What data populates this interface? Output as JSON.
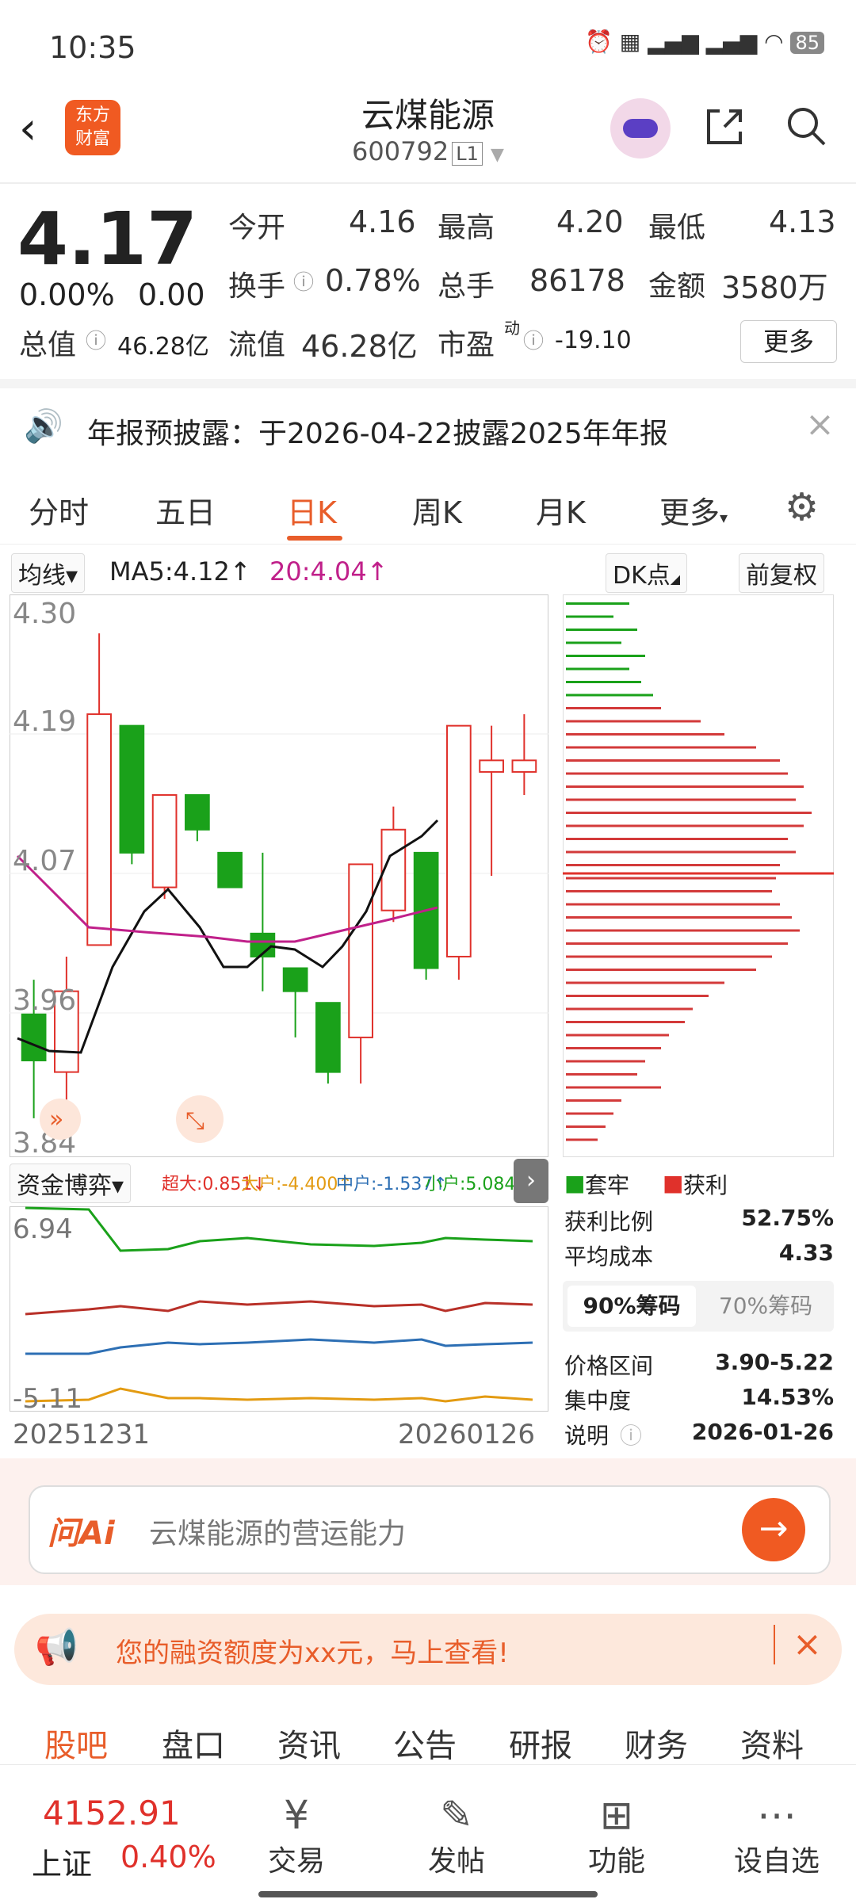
{
  "status_bar": {
    "time": "10:35",
    "battery": "85"
  },
  "header": {
    "back_icon": "chevron-left-icon",
    "logo_text_line1": "东方",
    "logo_text_line2": "财富",
    "title": "云煤能源",
    "code": "600792",
    "level": "L1"
  },
  "quote": {
    "price": "4.17",
    "change_pct": "0.00%",
    "change_abs": "0.00",
    "open_label": "今开",
    "open": "4.16",
    "high_label": "最高",
    "high": "4.20",
    "low_label": "最低",
    "low": "4.13",
    "turnover_label": "换手",
    "turnover": "0.78%",
    "volume_label": "总手",
    "volume": "86178",
    "amount_label": "金额",
    "amount": "3580万",
    "mktcap_label": "总值",
    "mktcap": "46.28亿",
    "float_label": "流值",
    "float": "46.28亿",
    "pe_label": "市盈",
    "pe_sup": "动",
    "pe": "-19.10",
    "more_label": "更多"
  },
  "notice": {
    "text": "年报预披露：于2026-04-22披露2025年年报"
  },
  "tabs": [
    {
      "label": "分时"
    },
    {
      "label": "五日"
    },
    {
      "label": "日K"
    },
    {
      "label": "周K"
    },
    {
      "label": "月K"
    },
    {
      "label": "更多"
    }
  ],
  "toolbar": {
    "indicator": "均线",
    "ma5": "MA5:4.12↑",
    "ma20": "20:4.04↑",
    "dk": "DK点",
    "adjust": "前复权"
  },
  "chart": {
    "y_labels": [
      "4.30",
      "4.19",
      "4.07",
      "3.96",
      "3.84"
    ],
    "sub_indicator": "资金博弈",
    "sub_legend": {
      "super": "超大:0.851↓",
      "big": "大户:-4.400↑",
      "mid": "中户:-1.537↑",
      "small": "小户:5.084↓"
    },
    "sub_top": "6.94",
    "sub_bottom": "-5.11",
    "date_start": "20251231",
    "date_end": "20260126"
  },
  "chart_data": {
    "type": "candlestick",
    "ylim": [
      3.84,
      4.3
    ],
    "candles": [
      {
        "o": 3.95,
        "h": 3.98,
        "l": 3.86,
        "c": 3.91,
        "up": false
      },
      {
        "o": 3.9,
        "h": 4.0,
        "l": 3.87,
        "c": 3.97,
        "up": true
      },
      {
        "o": 4.01,
        "h": 4.28,
        "l": 4.03,
        "c": 4.21,
        "up": true
      },
      {
        "o": 4.2,
        "h": 4.2,
        "l": 4.08,
        "c": 4.09,
        "up": false
      },
      {
        "o": 4.06,
        "h": 4.14,
        "l": 4.05,
        "c": 4.14,
        "up": true
      },
      {
        "o": 4.14,
        "h": 4.14,
        "l": 4.1,
        "c": 4.11,
        "up": false
      },
      {
        "o": 4.09,
        "h": 4.09,
        "l": 4.06,
        "c": 4.06,
        "up": false
      },
      {
        "o": 4.02,
        "h": 4.09,
        "l": 3.97,
        "c": 4.0,
        "up": false
      },
      {
        "o": 3.99,
        "h": 3.99,
        "l": 3.93,
        "c": 3.97,
        "up": false
      },
      {
        "o": 3.96,
        "h": 3.96,
        "l": 3.89,
        "c": 3.9,
        "up": false
      },
      {
        "o": 3.93,
        "h": 4.07,
        "l": 3.89,
        "c": 4.08,
        "up": true
      },
      {
        "o": 4.04,
        "h": 4.13,
        "l": 4.03,
        "c": 4.11,
        "up": true
      },
      {
        "o": 4.09,
        "h": 4.09,
        "l": 3.98,
        "c": 3.99,
        "up": false
      },
      {
        "o": 4.0,
        "h": 4.2,
        "l": 3.98,
        "c": 4.2,
        "up": true
      },
      {
        "o": 4.16,
        "h": 4.2,
        "l": 4.07,
        "c": 4.17,
        "up": true
      },
      {
        "o": 4.16,
        "h": 4.21,
        "l": 4.14,
        "c": 4.17,
        "up": true
      }
    ]
  },
  "chips": {
    "legend_trapped": "套牢",
    "legend_profit": "获利",
    "profit_ratio_label": "获利比例",
    "profit_ratio": "52.75%",
    "avg_cost_label": "平均成本",
    "avg_cost": "4.33",
    "tab90": "90%筹码",
    "tab70": "70%筹码",
    "range_label": "价格区间",
    "range": "3.90-5.22",
    "concentration_label": "集中度",
    "concentration": "14.53%",
    "note_label": "说明",
    "note_date": "2026-01-26"
  },
  "ask": {
    "brand": "问Ai",
    "placeholder": "云煤能源的营运能力"
  },
  "banner": {
    "text": "您的融资额度为xx元，马上查看!"
  },
  "nav_tabs": [
    {
      "label": "股吧"
    },
    {
      "label": "盘口"
    },
    {
      "label": "资讯"
    },
    {
      "label": "公告"
    },
    {
      "label": "研报"
    },
    {
      "label": "财务"
    },
    {
      "label": "资料"
    }
  ],
  "index": {
    "value": "4152.91",
    "name": "上证",
    "pct": "0.40%"
  },
  "bottom_bar": [
    {
      "label": "交易"
    },
    {
      "label": "发帖"
    },
    {
      "label": "功能"
    },
    {
      "label": "设自选"
    }
  ],
  "colors": {
    "up": "#e0312b",
    "down": "#1aa11a",
    "accent": "#e85d2a"
  }
}
